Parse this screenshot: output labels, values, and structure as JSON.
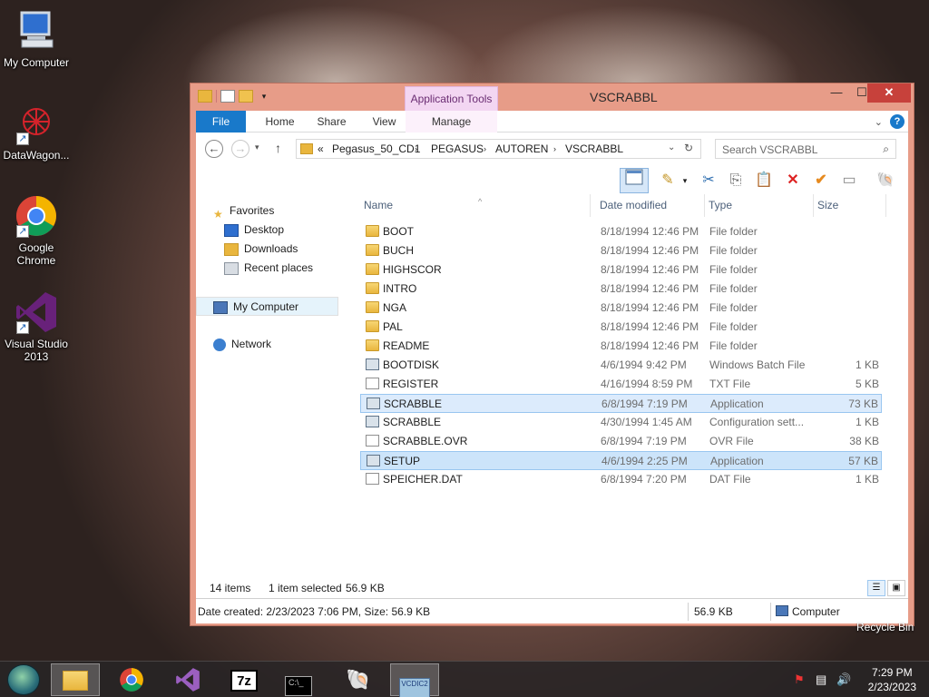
{
  "desktop": {
    "icons": [
      {
        "label": "My Computer",
        "icon": "computer-icon"
      },
      {
        "label": "DataWagon...",
        "icon": "datawagon-icon"
      },
      {
        "label": "Google Chrome",
        "icon": "chrome-icon"
      },
      {
        "label": "Visual Studio 2013",
        "icon": "visual-studio-icon"
      }
    ],
    "recycle_bin_label": "Recycle Bin"
  },
  "window": {
    "title": "VSCRABBL",
    "context_tab": "Application Tools",
    "ribbon_tabs": [
      "File",
      "Home",
      "Share",
      "View",
      "Manage"
    ],
    "address": {
      "overflow": "«",
      "crumbs": [
        "Pegasus_50_CD1",
        "PEGASUS",
        "AUTOREN",
        "VSCRABBL"
      ]
    },
    "search_placeholder": "Search VSCRABBL",
    "nav_pane": {
      "favorites": "Favorites",
      "desktop": "Desktop",
      "downloads": "Downloads",
      "recent": "Recent places",
      "my_computer": "My Computer",
      "network": "Network"
    },
    "columns": [
      "Name",
      "Date modified",
      "Type",
      "Size"
    ],
    "files": [
      {
        "name": "BOOT",
        "date": "8/18/1994 12:46 PM",
        "type": "File folder",
        "size": "",
        "kind": "folder"
      },
      {
        "name": "BUCH",
        "date": "8/18/1994 12:46 PM",
        "type": "File folder",
        "size": "",
        "kind": "folder"
      },
      {
        "name": "HIGHSCOR",
        "date": "8/18/1994 12:46 PM",
        "type": "File folder",
        "size": "",
        "kind": "folder"
      },
      {
        "name": "INTRO",
        "date": "8/18/1994 12:46 PM",
        "type": "File folder",
        "size": "",
        "kind": "folder"
      },
      {
        "name": "NGA",
        "date": "8/18/1994 12:46 PM",
        "type": "File folder",
        "size": "",
        "kind": "folder"
      },
      {
        "name": "PAL",
        "date": "8/18/1994 12:46 PM",
        "type": "File folder",
        "size": "",
        "kind": "folder"
      },
      {
        "name": "README",
        "date": "8/18/1994 12:46 PM",
        "type": "File folder",
        "size": "",
        "kind": "folder"
      },
      {
        "name": "BOOTDISK",
        "date": "4/6/1994 9:42 PM",
        "type": "Windows Batch File",
        "size": "1 KB",
        "kind": "gear"
      },
      {
        "name": "REGISTER",
        "date": "4/16/1994 8:59 PM",
        "type": "TXT File",
        "size": "5 KB",
        "kind": "doc"
      },
      {
        "name": "SCRABBLE",
        "date": "6/8/1994 7:19 PM",
        "type": "Application",
        "size": "73 KB",
        "kind": "app"
      },
      {
        "name": "SCRABBLE",
        "date": "4/30/1994 1:45 AM",
        "type": "Configuration sett...",
        "size": "1 KB",
        "kind": "gear"
      },
      {
        "name": "SCRABBLE.OVR",
        "date": "6/8/1994 7:19 PM",
        "type": "OVR File",
        "size": "38 KB",
        "kind": "doc"
      },
      {
        "name": "SETUP",
        "date": "4/6/1994 2:25 PM",
        "type": "Application",
        "size": "57 KB",
        "kind": "app"
      },
      {
        "name": "SPEICHER.DAT",
        "date": "6/8/1994 7:20 PM",
        "type": "DAT File",
        "size": "1 KB",
        "kind": "doc"
      }
    ],
    "status": {
      "items": "14 items",
      "selected": "1 item selected",
      "selected_size": "56.9 KB"
    },
    "details": {
      "info": "Date created: 2/23/2023 7:06 PM, Size: 56.9 KB",
      "size": "56.9 KB",
      "location": "Computer"
    }
  },
  "taskbar": {
    "time": "7:29 PM",
    "date": "2/23/2023",
    "seven_zip_label": "7z",
    "vcdi_label": "VCDIC2"
  }
}
